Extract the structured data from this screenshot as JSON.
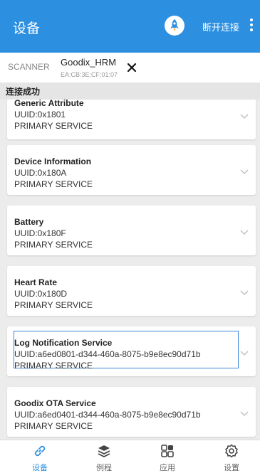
{
  "appbar": {
    "title": "设备",
    "disconnect_label": "断开连接"
  },
  "scanner": {
    "label": "SCANNER",
    "device_name": "Goodix_HRM",
    "device_mac": "EA:CB:3E:CF:01:07"
  },
  "status": {
    "text": "连接成功"
  },
  "services": [
    {
      "name": "Generic Attribute",
      "uuid": "UUID:0x1801",
      "type": "PRIMARY SERVICE"
    },
    {
      "name": "Device Information",
      "uuid": "UUID:0x180A",
      "type": "PRIMARY SERVICE"
    },
    {
      "name": "Battery",
      "uuid": "UUID:0x180F",
      "type": "PRIMARY SERVICE"
    },
    {
      "name": "Heart Rate",
      "uuid": "UUID:0x180D",
      "type": "PRIMARY SERVICE"
    },
    {
      "name": "Log Notification Service",
      "uuid": "UUID:a6ed0801-d344-460a-8075-b9e8ec90d71b",
      "type": "PRIMARY SERVICE"
    },
    {
      "name": "Goodix OTA Service",
      "uuid": "UUID:a6ed0401-d344-460a-8075-b9e8ec90d71b",
      "type": "PRIMARY SERVICE"
    }
  ],
  "nav": {
    "tabs": [
      {
        "label": "设备",
        "icon": "link-icon",
        "active": true
      },
      {
        "label": "例程",
        "icon": "layers-icon",
        "active": false
      },
      {
        "label": "应用",
        "icon": "apps-grid-icon",
        "active": false
      },
      {
        "label": "设置",
        "icon": "gear-icon",
        "active": false
      }
    ]
  },
  "colors": {
    "primary": "#2c8fe0",
    "selected_border": "#3a8ad8",
    "background": "#ececec"
  }
}
